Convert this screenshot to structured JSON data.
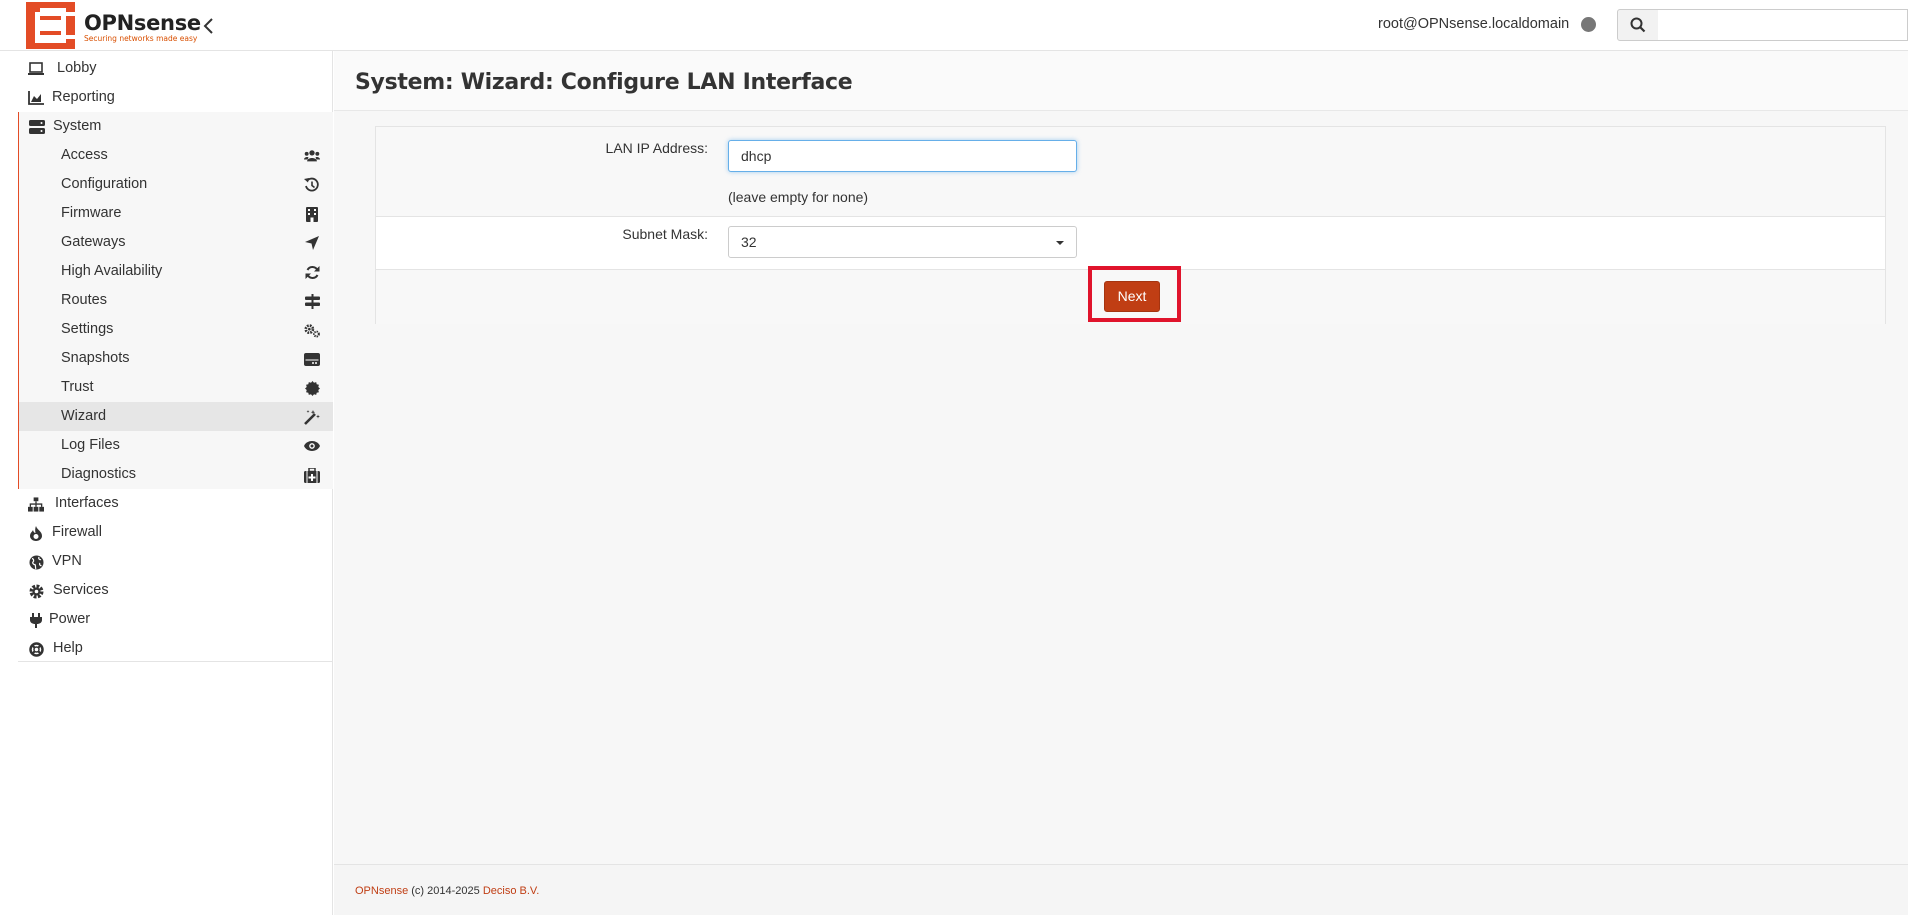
{
  "app": {
    "logo_text": "OPNsense",
    "logo_reg": "®",
    "logo_tagline": "Securing networks made easy",
    "user_label": "root@OPNsense.localdomain",
    "search_placeholder": ""
  },
  "sidebar": {
    "top_items": [
      {
        "label": "Lobby",
        "icon": "laptop-icon"
      },
      {
        "label": "Reporting",
        "icon": "area-chart-icon"
      },
      {
        "label": "System",
        "icon": "server-icon"
      }
    ],
    "system_items": [
      {
        "label": "Access",
        "icon": "users-icon"
      },
      {
        "label": "Configuration",
        "icon": "history-icon"
      },
      {
        "label": "Firmware",
        "icon": "building-icon"
      },
      {
        "label": "Gateways",
        "icon": "location-arrow-icon"
      },
      {
        "label": "High Availability",
        "icon": "refresh-icon"
      },
      {
        "label": "Routes",
        "icon": "signs-icon"
      },
      {
        "label": "Settings",
        "icon": "cogs-icon"
      },
      {
        "label": "Snapshots",
        "icon": "hdd-icon"
      },
      {
        "label": "Trust",
        "icon": "certificate-icon"
      },
      {
        "label": "Wizard",
        "icon": "magic-icon"
      },
      {
        "label": "Log Files",
        "icon": "eye-icon"
      },
      {
        "label": "Diagnostics",
        "icon": "medkit-icon"
      }
    ],
    "bottom_items": [
      {
        "label": "Interfaces",
        "icon": "sitemap-icon"
      },
      {
        "label": "Firewall",
        "icon": "fire-icon"
      },
      {
        "label": "VPN",
        "icon": "globe-icon"
      },
      {
        "label": "Services",
        "icon": "cog-icon"
      },
      {
        "label": "Power",
        "icon": "plug-icon"
      },
      {
        "label": "Help",
        "icon": "life-ring-icon"
      }
    ],
    "active_item": "Wizard"
  },
  "page": {
    "title": "System: Wizard: Configure LAN Interface"
  },
  "form": {
    "lan_ip_label": "LAN IP Address:",
    "lan_ip_value": "dhcp",
    "lan_ip_hint": "(leave empty for none)",
    "subnet_label": "Subnet Mask:",
    "subnet_value": "32",
    "next_label": "Next"
  },
  "footer": {
    "brand": "OPNsense",
    "copyright": " (c) 2014-2025 ",
    "company": "Deciso B.V."
  },
  "colors": {
    "accent": "#c03e14",
    "sidebar_marker": "#e34c26",
    "highlight": "#e0142c"
  }
}
